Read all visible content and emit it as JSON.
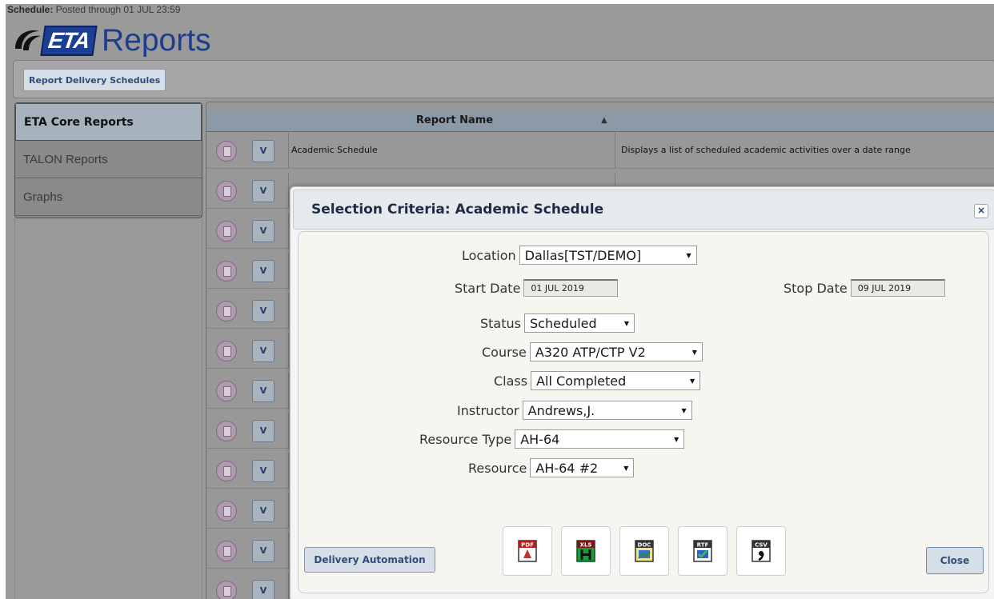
{
  "schedule_status": {
    "label": "Schedule:",
    "text": "Posted through 01 JUL 23:59"
  },
  "logo": {
    "brand": "ETA",
    "title": "Reports"
  },
  "toolbar": {
    "report_delivery_schedules": "Report Delivery Schedules"
  },
  "sidebar": {
    "items": [
      {
        "label": "ETA Core Reports",
        "active": true
      },
      {
        "label": "TALON Reports",
        "active": false
      },
      {
        "label": "Graphs",
        "active": false
      }
    ]
  },
  "grid": {
    "column_header": "Report Name",
    "sort_indicator": "▲",
    "rows": [
      {
        "v_label": "V",
        "name": "Academic Schedule",
        "description": "Displays a list of scheduled academic activities over a date range"
      },
      {
        "v_label": "V",
        "name": "",
        "description": ""
      },
      {
        "v_label": "V",
        "name": "",
        "description": ""
      },
      {
        "v_label": "V",
        "name": "",
        "description": ""
      },
      {
        "v_label": "V",
        "name": "",
        "description": ""
      },
      {
        "v_label": "V",
        "name": "",
        "description": ""
      },
      {
        "v_label": "V",
        "name": "",
        "description": ""
      },
      {
        "v_label": "V",
        "name": "",
        "description": ""
      },
      {
        "v_label": "V",
        "name": "",
        "description": ""
      },
      {
        "v_label": "V",
        "name": "",
        "description": ""
      },
      {
        "v_label": "V",
        "name": "",
        "description": ""
      },
      {
        "v_label": "V",
        "name": "",
        "description": ""
      }
    ]
  },
  "dialog": {
    "title": "Selection Criteria: Academic Schedule",
    "close_x": "×",
    "fields": {
      "location": {
        "label": "Location",
        "value": "Dallas[TST/DEMO]"
      },
      "start_date": {
        "label": "Start Date",
        "value": "01 JUL 2019"
      },
      "stop_date": {
        "label": "Stop Date",
        "value": "09 JUL 2019"
      },
      "status": {
        "label": "Status",
        "value": "Scheduled"
      },
      "course": {
        "label": "Course",
        "value": "A320 ATP/CTP V2"
      },
      "class": {
        "label": "Class",
        "value": "All Completed"
      },
      "instructor": {
        "label": "Instructor",
        "value": "Andrews,J."
      },
      "resource_type": {
        "label": "Resource Type",
        "value": "AH-64"
      },
      "resource": {
        "label": "Resource",
        "value": "AH-64 #2"
      }
    },
    "select_arrow": "▼",
    "export_icons": [
      {
        "name": "pdf-export-icon",
        "tag": "PDF"
      },
      {
        "name": "excel-export-icon",
        "tag": "XLS"
      },
      {
        "name": "word-export-icon",
        "tag": "DOC"
      },
      {
        "name": "rtf-export-icon",
        "tag": "RTF"
      },
      {
        "name": "csv-export-icon",
        "tag": "CSV"
      }
    ],
    "delivery_automation": "Delivery Automation",
    "close_label": "Close"
  },
  "colors": {
    "overlay_gray": "#9a9a9a",
    "dialog_title_text": "#1e2c44",
    "button_text": "#2f4d7a",
    "logo_blue": "#1c3f94"
  }
}
